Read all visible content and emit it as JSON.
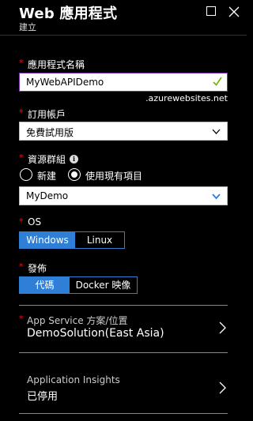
{
  "header": {
    "title": "Web 應用程式",
    "subtitle": "建立",
    "maximize_icon": "square-icon",
    "close_icon": "close-icon"
  },
  "required_mark": "*",
  "app_name": {
    "label": "應用程式名稱",
    "value": "MyWebAPIDemo",
    "suffix": ".azurewebsites.net",
    "valid_icon": "checkmark-icon"
  },
  "subscription": {
    "label": "訂用帳戶",
    "value": "免費試用版"
  },
  "resource_group": {
    "label": "資源群組",
    "info_icon_glyph": "i",
    "options": [
      "新建",
      "使用現有項目"
    ],
    "selected_option": 1,
    "value": "MyDemo"
  },
  "os": {
    "label": "OS",
    "options": [
      "Windows",
      "Linux"
    ],
    "selected_option": 0
  },
  "publish": {
    "label": "發佈",
    "options": [
      "代碼",
      "Docker 映像"
    ],
    "selected_option": 0
  },
  "app_service_plan": {
    "label": "App Service 方案/位置",
    "value": "DemoSolution(East Asia)"
  },
  "app_insights": {
    "label": "Application Insights",
    "value": "已停用"
  },
  "colors": {
    "background": "#000000",
    "accent_blue": "#2f7fd6",
    "required_red": "#e81123",
    "input_focus_border": "#7a2fb8",
    "valid_green": "#6bb700"
  }
}
